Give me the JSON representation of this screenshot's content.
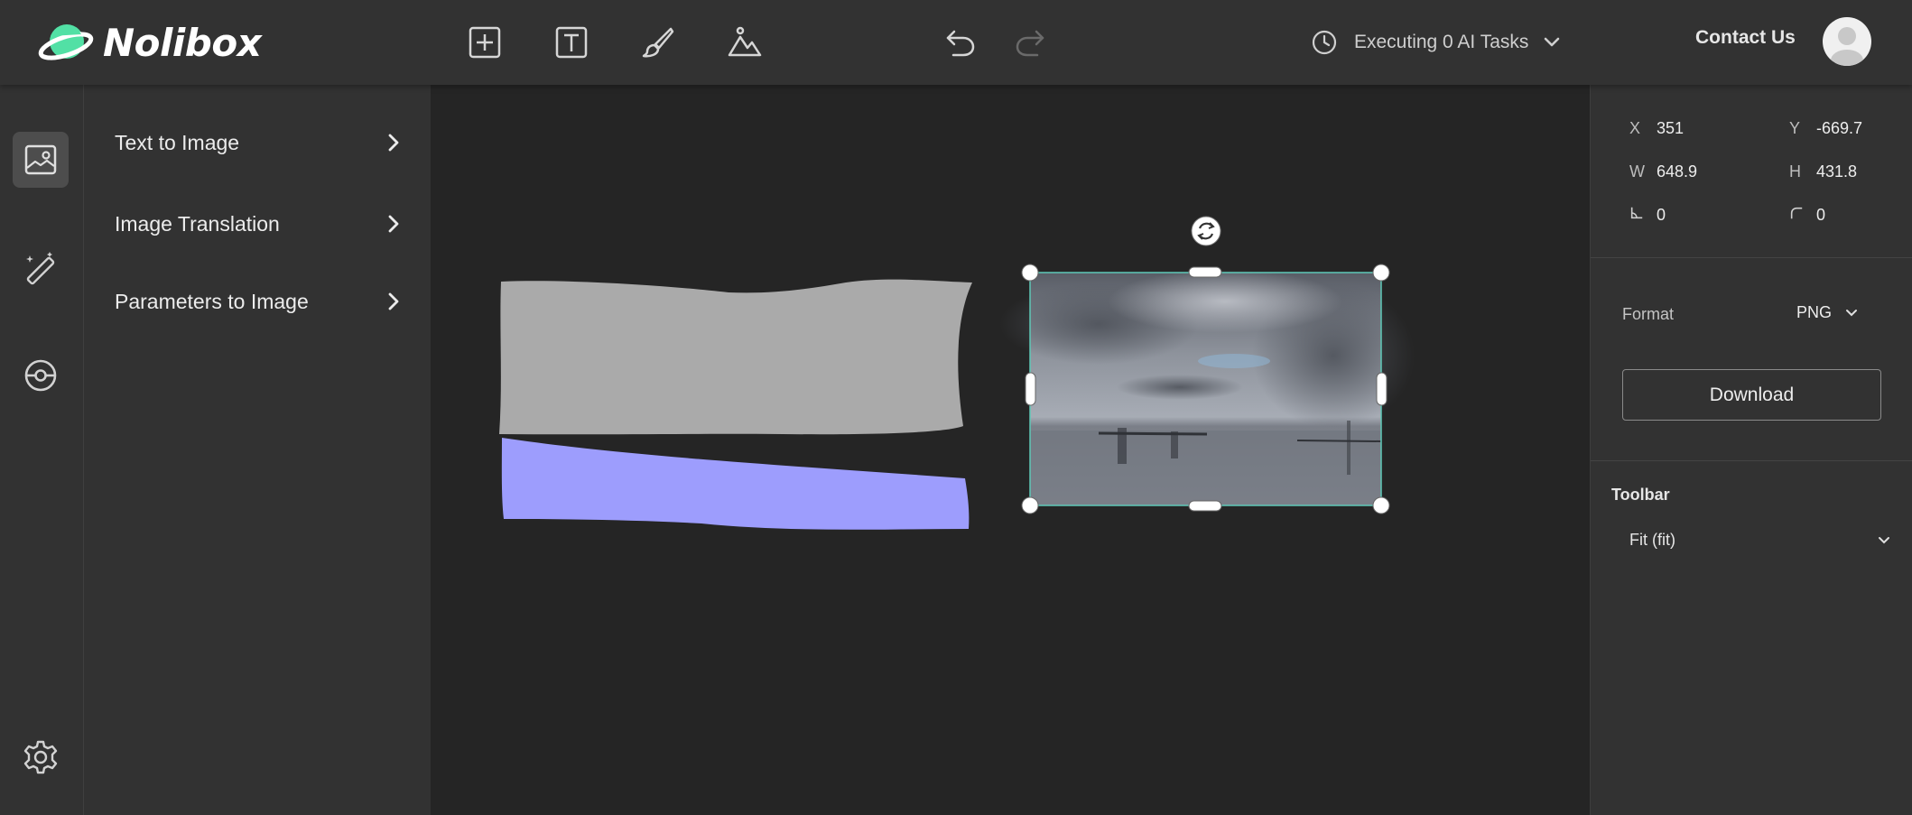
{
  "app": {
    "name": "Nolibox"
  },
  "header": {
    "tools": [
      {
        "name": "add-icon"
      },
      {
        "name": "text-icon"
      },
      {
        "name": "brush-icon"
      },
      {
        "name": "image-icon"
      }
    ],
    "history": [
      {
        "name": "undo-icon",
        "enabled": true
      },
      {
        "name": "redo-icon",
        "enabled": false
      }
    ],
    "tasks_label": "Executing 0 AI Tasks",
    "contact_label": "Contact Us"
  },
  "rail": [
    {
      "name": "image-panel-icon",
      "active": true
    },
    {
      "name": "magic-wand-icon",
      "active": false
    },
    {
      "name": "pokeball-icon",
      "active": false
    },
    {
      "name": "settings-icon",
      "active": false
    }
  ],
  "menu": {
    "items": [
      {
        "label": "Text to Image"
      },
      {
        "label": "Image Translation"
      },
      {
        "label": "Parameters to Image"
      }
    ]
  },
  "properties": {
    "x": {
      "label": "X",
      "value": "351"
    },
    "y": {
      "label": "Y",
      "value": "-669.7"
    },
    "w": {
      "label": "W",
      "value": "648.9"
    },
    "h": {
      "label": "H",
      "value": "431.8"
    },
    "skew": {
      "value": "0"
    },
    "radius": {
      "value": "0"
    },
    "format_label": "Format",
    "format_value": "PNG",
    "download_label": "Download",
    "toolbar_title": "Toolbar",
    "toolbar_value": "Fit (fit)"
  },
  "colors": {
    "accent_selection": "#5fc9b8",
    "sketch_gray": "#aaaaaa",
    "sketch_purple": "#9d9dfd",
    "logo_green": "#52e0a5"
  }
}
